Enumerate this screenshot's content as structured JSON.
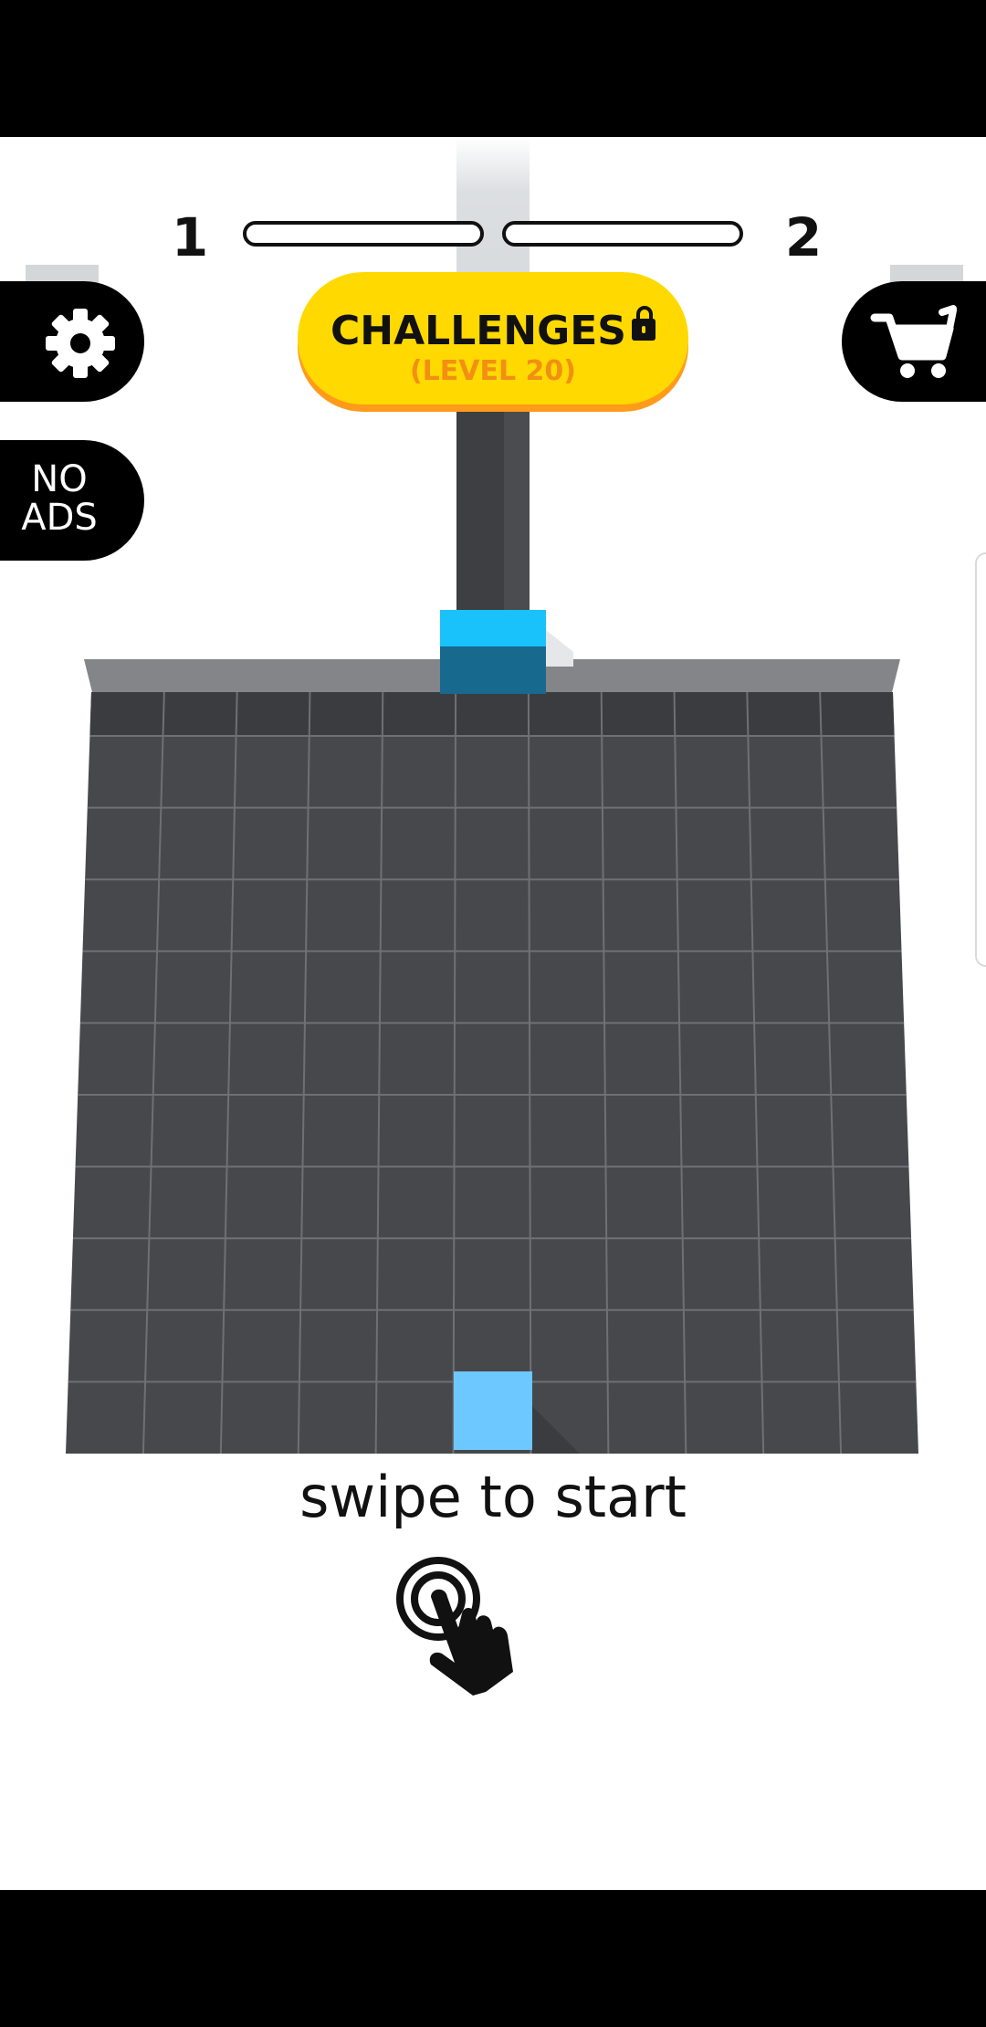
{
  "progress": {
    "current_level": "1",
    "next_level": "2",
    "fill": 0
  },
  "challenges": {
    "title": "CHALLENGES",
    "subtitle": "(LEVEL 20)",
    "icon": "lock-icon"
  },
  "buttons": {
    "settings_icon": "gear-icon",
    "no_ads_line1": "NO",
    "no_ads_line2": "ADS",
    "shop_icon": "cart-icon"
  },
  "board": {
    "columns": 11,
    "rows": 11,
    "player_color": "#19c2fb",
    "target_color": "#6cc8ff",
    "board_color": "#46484c"
  },
  "prompt": {
    "text": "swipe to start",
    "icon": "tap-hand-icon"
  }
}
